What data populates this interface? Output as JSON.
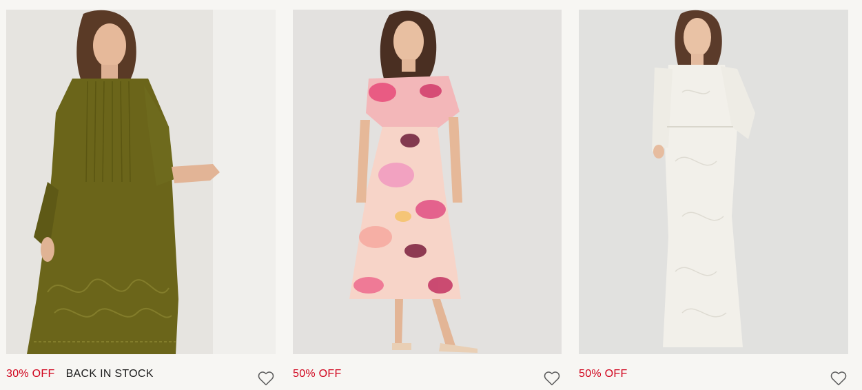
{
  "products": [
    {
      "image_alt": "Olive velvet midi dress with embroidery",
      "badges": {
        "sale": "30% OFF",
        "stock": "BACK IN STOCK"
      },
      "wishlist_icon": "heart-outline-icon"
    },
    {
      "image_alt": "Pink floral print cape-sleeve midi dress",
      "badges": {
        "sale": "50% OFF",
        "stock": ""
      },
      "wishlist_icon": "heart-outline-icon"
    },
    {
      "image_alt": "Ivory satin jacquard long-sleeve maxi dress",
      "badges": {
        "sale": "50% OFF",
        "stock": ""
      },
      "wishlist_icon": "heart-outline-icon"
    }
  ],
  "colors": {
    "background": "#f7f6f3",
    "sale": "#d0021b",
    "text": "#1a1a1a"
  }
}
